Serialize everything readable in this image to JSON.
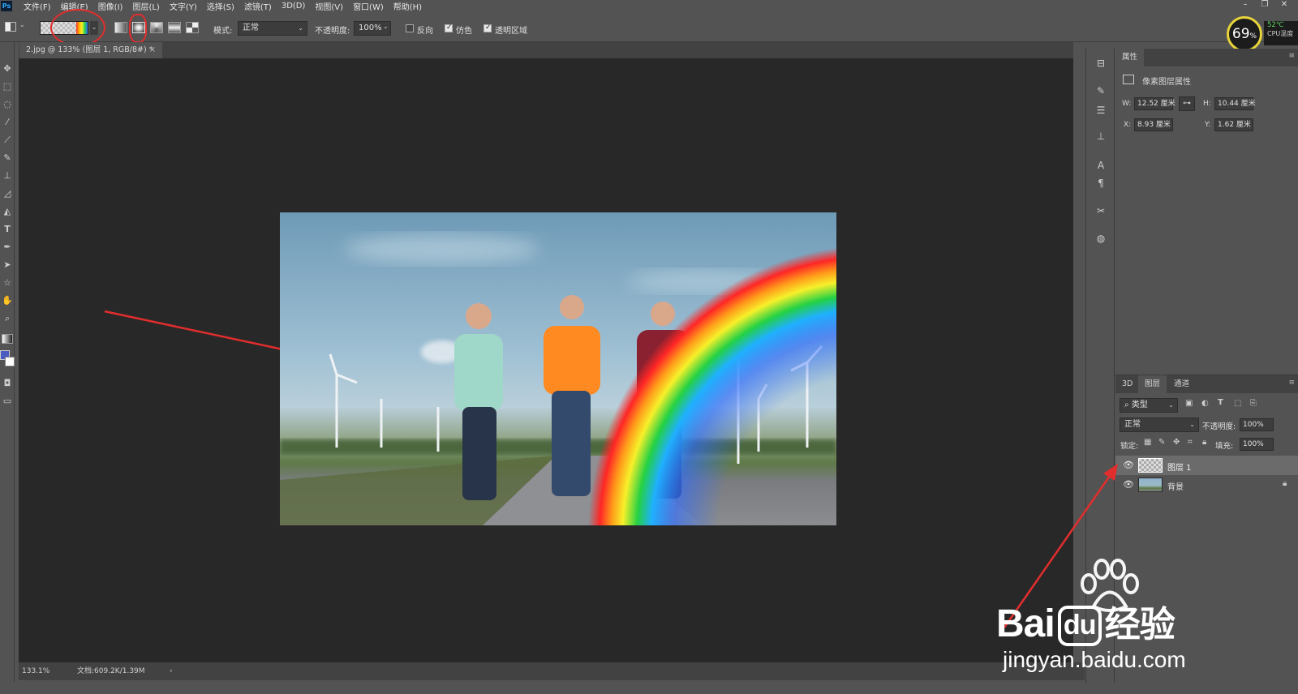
{
  "menubar": {
    "logo": "Ps",
    "items": [
      "文件(F)",
      "编辑(E)",
      "图像(I)",
      "图层(L)",
      "文字(Y)",
      "选择(S)",
      "滤镜(T)",
      "3D(D)",
      "视图(V)",
      "窗口(W)",
      "帮助(H)"
    ]
  },
  "options": {
    "mode_label": "模式:",
    "mode_value": "正常",
    "opacity_label": "不透明度:",
    "opacity_value": "100%",
    "reverse_label": "反向",
    "reverse_checked": false,
    "dither_label": "仿色",
    "dither_checked": true,
    "transparency_label": "透明区域",
    "transparency_checked": true
  },
  "document": {
    "tab_title": "2.jpg @ 133% (图层 1, RGB/8#) *",
    "zoom": "133.1%",
    "doc_size": "文档:609.2K/1.39M"
  },
  "cpu": {
    "usage": "69",
    "unit": "%",
    "temp": "52℃",
    "label": "CPU温度"
  },
  "properties": {
    "tab": "属性",
    "title": "像素图层属性",
    "w_label": "W:",
    "w_value": "12.52 厘米",
    "h_label": "H:",
    "h_value": "10.44 厘米",
    "x_label": "X:",
    "x_value": "8.93 厘米",
    "y_label": "Y:",
    "y_value": "1.62 厘米"
  },
  "layers_panel": {
    "tabs": [
      "3D",
      "图层",
      "通道"
    ],
    "filter_label": "类型",
    "blend_mode": "正常",
    "opacity_label": "不透明度:",
    "opacity_value": "100%",
    "lock_label": "锁定:",
    "fill_label": "填充:",
    "fill_value": "100%",
    "layers": [
      {
        "name": "图层 1",
        "selected": true
      },
      {
        "name": "背景",
        "selected": false,
        "locked": true
      }
    ]
  },
  "watermark": {
    "brand_1": "Bai",
    "brand_2": "du",
    "brand_3": "经验",
    "url": "jingyan.baidu.com"
  },
  "colors": {
    "ui_bg": "#535353",
    "canvas_bg": "#282828",
    "annotation": "#e22d2d",
    "cpu_ring": "#e8d43b"
  }
}
